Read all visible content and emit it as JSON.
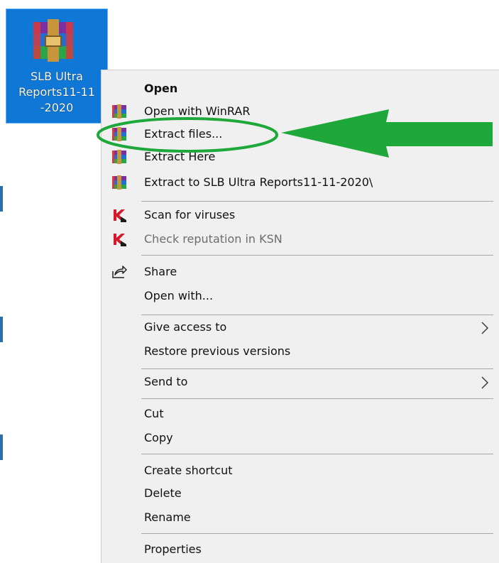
{
  "desktop": {
    "file_icon": {
      "label": "SLB Ultra\nReports11-11\n-2020",
      "icon": "winrar-archive-icon"
    }
  },
  "context_menu": {
    "items": [
      {
        "label": "Open",
        "bold": true
      },
      {
        "label": "Open with WinRAR",
        "icon": "winrar-icon"
      },
      {
        "label": "Extract files...",
        "icon": "winrar-icon",
        "highlighted_by_annotation": true
      },
      {
        "label": "Extract Here",
        "icon": "winrar-icon"
      },
      {
        "label": "Extract to SLB Ultra Reports11-11-2020\\",
        "icon": "winrar-icon"
      },
      {
        "label": "Scan for viruses",
        "icon": "kaspersky-icon"
      },
      {
        "label": "Check reputation in KSN",
        "icon": "kaspersky-icon",
        "disabled": true
      },
      {
        "label": "Share",
        "icon": "share-icon"
      },
      {
        "label": "Open with..."
      },
      {
        "label": "Give access to",
        "submenu": true
      },
      {
        "label": "Restore previous versions"
      },
      {
        "label": "Send to",
        "submenu": true
      },
      {
        "label": "Cut"
      },
      {
        "label": "Copy"
      },
      {
        "label": "Create shortcut"
      },
      {
        "label": "Delete"
      },
      {
        "label": "Rename"
      },
      {
        "label": "Properties"
      }
    ]
  },
  "annotation": {
    "color": "#1fa83a",
    "shapes": [
      "ellipse-around-extract-files",
      "arrow-pointing-left"
    ]
  }
}
